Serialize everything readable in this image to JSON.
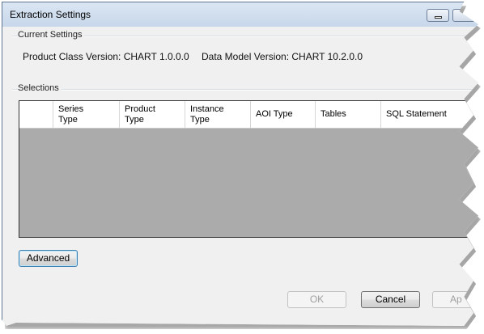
{
  "window": {
    "title": "Extraction Settings"
  },
  "current_settings": {
    "group_label": "Current Settings",
    "product_class_version": "Product Class Version: CHART 1.0.0.0",
    "data_model_version": "Data Model Version: CHART 10.2.0.0"
  },
  "selections": {
    "group_label": "Selections",
    "columns": [
      {
        "line1": "Series",
        "line2": "Type"
      },
      {
        "line1": "Product",
        "line2": "Type"
      },
      {
        "line1": "Instance",
        "line2": "Type"
      },
      {
        "line1": "AOI Type",
        "line2": ""
      },
      {
        "line1": "Tables",
        "line2": ""
      },
      {
        "line1": "SQL Statement",
        "line2": ""
      }
    ]
  },
  "buttons": {
    "advanced": "Advanced",
    "ok": "OK",
    "cancel": "Cancel",
    "apply": "Ap"
  }
}
